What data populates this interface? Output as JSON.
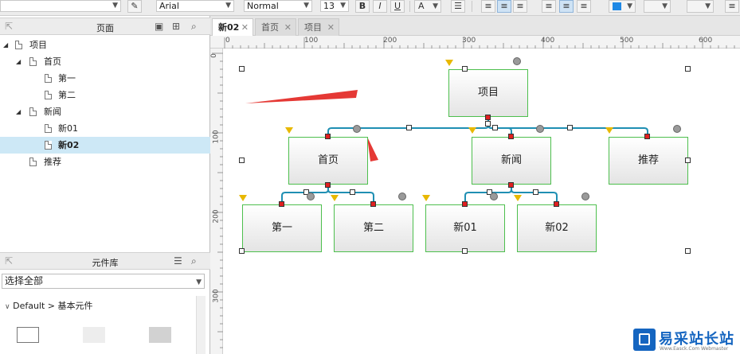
{
  "toolbar": {
    "font": "Arial",
    "style": "Normal",
    "size": "13",
    "bold": "B",
    "italic": "I",
    "underline": "U",
    "fontcolor": "A"
  },
  "pages_panel": {
    "title": "页面"
  },
  "tree": [
    {
      "label": "项目",
      "level": 0,
      "expanded": true
    },
    {
      "label": "首页",
      "level": 1,
      "expanded": true
    },
    {
      "label": "第一",
      "level": 2
    },
    {
      "label": "第二",
      "level": 2
    },
    {
      "label": "新闻",
      "level": 1,
      "expanded": true
    },
    {
      "label": "新01",
      "level": 2
    },
    {
      "label": "新02",
      "level": 2,
      "selected": true
    },
    {
      "label": "推荐",
      "level": 1
    }
  ],
  "library_panel": {
    "title": "元件库",
    "select": "选择全部",
    "path": "Default > 基本元件"
  },
  "tabs": [
    {
      "label": "新02",
      "active": true
    },
    {
      "label": "首页"
    },
    {
      "label": "项目"
    }
  ],
  "ruler_h": [
    "0",
    "100",
    "200",
    "300",
    "400",
    "500",
    "600"
  ],
  "ruler_v": [
    "0",
    "100",
    "200",
    "300"
  ],
  "nodes": {
    "root": "项目",
    "home": "首页",
    "news": "新闻",
    "rec": "推荐",
    "c1": "第一",
    "c2": "第二",
    "n1": "新01",
    "n2": "新02"
  },
  "colors": {
    "connector": "#1f8fb3",
    "node_border": "#4dbf4d",
    "annotation": "#e53935",
    "selected_row": "#cde8f6"
  },
  "watermark": {
    "brand": "易采站长站",
    "url": "Www.Easck.Com Webmaster"
  }
}
